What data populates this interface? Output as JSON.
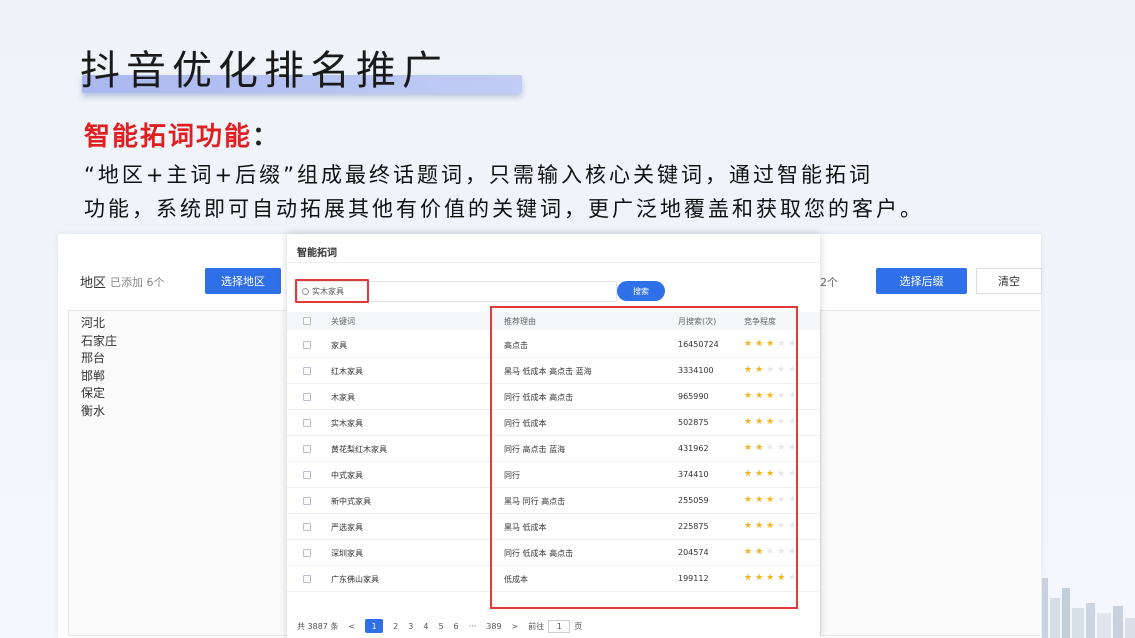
{
  "slide": {
    "title": "抖音优化排名推广",
    "subtitle": "智能拓词功能",
    "subtitle_colon": "：",
    "description_line1": "“地区+主词+后缀”组成最终话题词，只需输入核心关键词，通过智能拓词",
    "description_line2": "功能，系统即可自动拓展其他有价值的关键词，更广泛地覆盖和获取您的客户。"
  },
  "back_panel": {
    "region_label": "地区",
    "region_count": "已添加 6个",
    "select_region_button": "选择地区",
    "suffix_count": "2个",
    "select_suffix_button": "选择后缀",
    "clear_button": "清空",
    "regions": [
      "河北",
      "石家庄",
      "邢台",
      "邯郸",
      "保定",
      "衡水"
    ]
  },
  "modal": {
    "title": "智能拓词",
    "search_value": "实木家具",
    "search_button": "搜索",
    "columns": {
      "keyword": "关键词",
      "reason": "推荐理由",
      "monthly": "月搜索(次)",
      "competition": "竞争程度"
    },
    "rows": [
      {
        "keyword": "家具",
        "reason": "高点击",
        "monthly": "16450724",
        "stars": 3
      },
      {
        "keyword": "红木家具",
        "reason": "黑马 低成本 高点击 蓝海",
        "monthly": "3334100",
        "stars": 2
      },
      {
        "keyword": "木家具",
        "reason": "同行 低成本 高点击",
        "monthly": "965990",
        "stars": 3
      },
      {
        "keyword": "实木家具",
        "reason": "同行 低成本",
        "monthly": "502875",
        "stars": 3
      },
      {
        "keyword": "黄花梨红木家具",
        "reason": "同行 高点击 蓝海",
        "monthly": "431962",
        "stars": 2
      },
      {
        "keyword": "中式家具",
        "reason": "同行",
        "monthly": "374410",
        "stars": 3
      },
      {
        "keyword": "新中式家具",
        "reason": "黑马 同行 高点击",
        "monthly": "255059",
        "stars": 3
      },
      {
        "keyword": "严选家具",
        "reason": "黑马 低成本",
        "monthly": "225875",
        "stars": 3
      },
      {
        "keyword": "深圳家具",
        "reason": "同行 低成本 高点击",
        "monthly": "204574",
        "stars": 2
      },
      {
        "keyword": "广东佛山家具",
        "reason": "低成本",
        "monthly": "199112",
        "stars": 4
      }
    ],
    "pagination": {
      "total": "共 3887 条",
      "prev": "<",
      "pages": [
        "1",
        "2",
        "3",
        "4",
        "5",
        "6"
      ],
      "ellipsis": "···",
      "last": "389",
      "next": ">",
      "goto_label": "前往",
      "goto_value": "1",
      "goto_suffix": "页"
    }
  },
  "colors": {
    "accent_blue": "#2f6fe8",
    "highlight_red": "#e03a3a",
    "star": "#f5b21a"
  }
}
